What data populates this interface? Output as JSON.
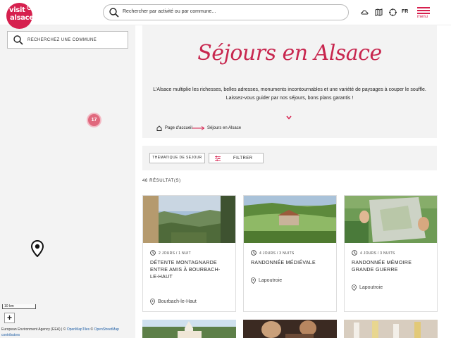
{
  "header": {
    "logo": {
      "line1": "visit",
      "line2": "alsace",
      "mark": "®"
    },
    "search_placeholder": "Rechercher par activité ou par commune...",
    "icons": [
      "weather-icon",
      "map-icon",
      "compass-icon"
    ],
    "lang": "FR",
    "menu_label": "menu"
  },
  "map": {
    "commune_placeholder": "RECHERCHEZ UNE COMMUNE",
    "cluster_count": "17",
    "zoom_in": "+",
    "scale": "10 km",
    "attribution": {
      "part1": "European Environment Agency (EEA) | © ",
      "link1": "OpenMapTiles",
      "part2": " © ",
      "link2": "OpenStreetMap",
      "part3": "contributors"
    }
  },
  "hero": {
    "title": "Séjours en Alsace",
    "text_line1": "L'Alsace multiplie les richesses, belles adresses, monuments incontournables et une variété de paysages à couper le souffle.",
    "text_line2": "Laissez-vous guider par nos séjours, bons plans garantis !",
    "breadcrumb": {
      "home": "Page d'accueil",
      "current": "Séjours en Alsace"
    }
  },
  "filters": {
    "theme_label": "THÉMATIQUE DE SÉJOUR",
    "filter_label": "FILTRER"
  },
  "results_label": "46 RÉSULTAT(S)",
  "cards": [
    {
      "duration": "2 JOURS / 1 NUIT",
      "title": "Détente montagnarde entre amis à Bourbach-le-Haut",
      "location": "Bourbach-le-Haut"
    },
    {
      "duration": "4 JOURS / 3 NUITS",
      "title": "Randonnée médiévale",
      "location": "Lapoutroie"
    },
    {
      "duration": "4 JOURS / 3 NUITS",
      "title": "Randonnée mémoire Grande Guerre",
      "location": "Lapoutroie"
    }
  ],
  "colors": {
    "brand": "#d6204e",
    "panel": "#f3f3f3",
    "cluster": "#e0687d"
  }
}
